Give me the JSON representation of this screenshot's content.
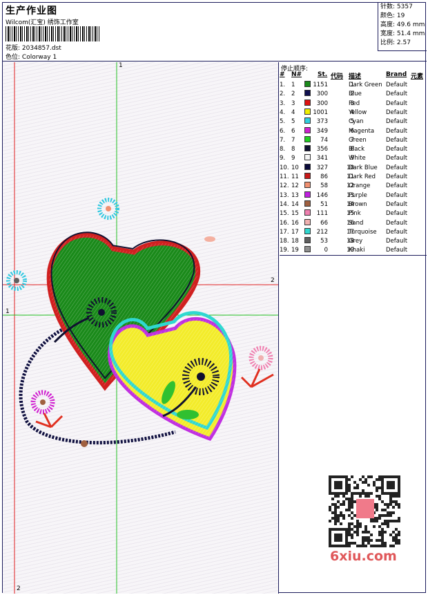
{
  "header": {
    "title": "生产作业图",
    "company": "Wilcom(汇宝) 绣饰工作室",
    "pattern_label": "花版:",
    "pattern_value": "2034857.dst",
    "colorway_label": "色位:",
    "colorway_value": "Colorway 1"
  },
  "stats": [
    {
      "label": "针数:",
      "value": "5357"
    },
    {
      "label": "颜色:",
      "value": "19"
    },
    {
      "label": "高度:",
      "value": "49.6 mm"
    },
    {
      "label": "宽度:",
      "value": "51.4 mm"
    },
    {
      "label": "比例:",
      "value": "2.57"
    }
  ],
  "guides": {
    "top_1": "1",
    "right_2": "2",
    "left_1": "1",
    "bottom_2": "2"
  },
  "stop_sequence": {
    "title": "停止顺序:",
    "columns": {
      "idx": "#",
      "no": "N#",
      "st": "St.",
      "code": "代码",
      "desc": "描述",
      "brand": "Brand",
      "elem": "元素"
    },
    "rows": [
      {
        "idx": "1.",
        "no": "1",
        "color": "#1a8a1a",
        "st": "1151",
        "code": "1",
        "desc": "Dark Green",
        "brand": "Default"
      },
      {
        "idx": "2.",
        "no": "2",
        "color": "#101050",
        "st": "300",
        "code": "2",
        "desc": "Blue",
        "brand": "Default"
      },
      {
        "idx": "3.",
        "no": "3",
        "color": "#e01010",
        "st": "300",
        "code": "3",
        "desc": "Red",
        "brand": "Default"
      },
      {
        "idx": "4.",
        "no": "4",
        "color": "#f0f000",
        "st": "1001",
        "code": "4",
        "desc": "Yellow",
        "brand": "Default"
      },
      {
        "idx": "5.",
        "no": "5",
        "color": "#30d0e0",
        "st": "373",
        "code": "5",
        "desc": "Cyan",
        "brand": "Default"
      },
      {
        "idx": "6.",
        "no": "6",
        "color": "#d020d0",
        "st": "349",
        "code": "6",
        "desc": "Magenta",
        "brand": "Default"
      },
      {
        "idx": "7.",
        "no": "7",
        "color": "#20d020",
        "st": "74",
        "code": "7",
        "desc": "Green",
        "brand": "Default"
      },
      {
        "idx": "8.",
        "no": "8",
        "color": "#101030",
        "st": "356",
        "code": "8",
        "desc": "Black",
        "brand": "Default"
      },
      {
        "idx": "9.",
        "no": "9",
        "color": "#f4f4f4",
        "st": "341",
        "code": "9",
        "desc": "White",
        "brand": "Default"
      },
      {
        "idx": "10.",
        "no": "10",
        "color": "#0a0a3a",
        "st": "327",
        "code": "10",
        "desc": "Dark Blue",
        "brand": "Default"
      },
      {
        "idx": "11.",
        "no": "11",
        "color": "#c81818",
        "st": "86",
        "code": "11",
        "desc": "Dark Red",
        "brand": "Default"
      },
      {
        "idx": "12.",
        "no": "12",
        "color": "#f09070",
        "st": "58",
        "code": "12",
        "desc": "Orange",
        "brand": "Default"
      },
      {
        "idx": "13.",
        "no": "13",
        "color": "#c020e0",
        "st": "146",
        "code": "13",
        "desc": "Purple",
        "brand": "Default"
      },
      {
        "idx": "14.",
        "no": "14",
        "color": "#a06040",
        "st": "51",
        "code": "14",
        "desc": "Brown",
        "brand": "Default"
      },
      {
        "idx": "15.",
        "no": "15",
        "color": "#f080b0",
        "st": "111",
        "code": "15",
        "desc": "Pink",
        "brand": "Default"
      },
      {
        "idx": "16.",
        "no": "16",
        "color": "#f0b0b0",
        "st": "66",
        "code": "16",
        "desc": "Sand",
        "brand": "Default"
      },
      {
        "idx": "17.",
        "no": "17",
        "color": "#30d8d0",
        "st": "212",
        "code": "17",
        "desc": "Turquoise",
        "brand": "Default"
      },
      {
        "idx": "18.",
        "no": "18",
        "color": "#606060",
        "st": "53",
        "code": "18",
        "desc": "Grey",
        "brand": "Default"
      },
      {
        "idx": "19.",
        "no": "19",
        "color": "#909090",
        "st": "0",
        "code": "19",
        "desc": "Khaki",
        "brand": "Default"
      }
    ]
  },
  "watermark": {
    "site": "6xiu.com",
    "qr_icon": "qr-code-icon"
  }
}
